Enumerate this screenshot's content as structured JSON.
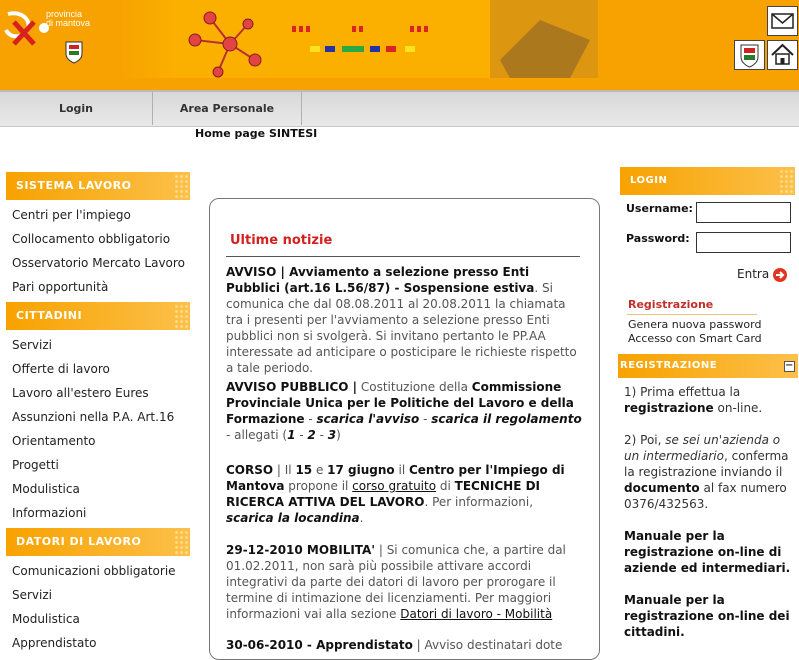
{
  "header": {
    "logo_line1": "provincia",
    "logo_line2": "di mantova",
    "icons": [
      "provincia-logo-icon",
      "coat-of-arms-icon",
      "molecule-icon",
      "mail-icon",
      "home-icon"
    ],
    "colors": {
      "brand_orange": "#f7a200",
      "accent_red": "#d32020"
    }
  },
  "nav": {
    "tabs": [
      {
        "label": "Login"
      },
      {
        "label": "Area Personale"
      }
    ],
    "breadcrumb": "Home page SINTESI"
  },
  "sidebar": {
    "sections": [
      {
        "title": "SISTEMA LAVORO",
        "items": [
          "Centri per l'impiego",
          "Collocamento obbligatorio",
          "Osservatorio Mercato Lavoro",
          "Pari opportunità"
        ]
      },
      {
        "title": "CITTADINI",
        "items": [
          "Servizi",
          "Offerte di lavoro",
          "Lavoro all'estero Eures",
          "Assunzioni nella P.A. Art.16",
          "Orientamento",
          "Progetti",
          "Modulistica",
          "Informazioni"
        ]
      },
      {
        "title": "DATORI DI LAVORO",
        "items": [
          "Comunicazioni obbligatorie",
          "Servizi",
          "Modulistica",
          "Apprendistato"
        ]
      }
    ]
  },
  "main": {
    "title": "Ultime notizie",
    "news": [
      {
        "heading": "AVVISO | Avviamento a selezione presso Enti Pubblici (art.16 L.56/87) - ",
        "heading_strong": "Sospensione estiva",
        "body": ". Si comunica che dal 08.08.2011 al 20.08.2011 la chiamata tra i presenti per l'avviamento a selezione presso Enti pubblici non si svolgerà. Si invitano pertanto le PP.AA interessate ad anticipare o posticipare le richieste rispetto a tale periodo."
      },
      {
        "t1": "AVVISO PUBBLICO |",
        "t2": " Costituzione della ",
        "t3": "Commissione Provinciale Unica per le Politiche del Lavoro e della Formazione",
        "t4": " - ",
        "t5": "scarica l'avviso",
        "t6": " - ",
        "t7": "scarica il regolamento",
        "t8": " - allegati (",
        "t9": "1",
        "t10": " - ",
        "t11": "2",
        "t12": " - ",
        "t13": "3",
        "t14": ")"
      },
      {
        "t1": "CORSO",
        "t2": " | Il ",
        "t3": "15",
        "t4": " e ",
        "t5": "17 giugno",
        "t6": " il ",
        "t7": "Centro per l'Impiego di Mantova",
        "t8": " propone il ",
        "t9": "corso gratuito",
        "t10": " di ",
        "t11": "TECNICHE DI RICERCA ATTIVA DEL LAVORO",
        "t12": ". Per informazioni, ",
        "t13": "scarica la locandina",
        "t14": "."
      },
      {
        "t1": "29-12-2010 MOBILITA'",
        "t2": " | Si comunica che, a partire dal 01.02.2011, non sarà più possibile attivare accordi integrativi da parte dei datori di lavoro per prorogare il termine di intimazione dei licenziamenti. Per maggiori informazioni vai alla sezione ",
        "t3": "Datori di lavoro - Mobilità"
      },
      {
        "t1": "30-06-2010 - Apprendistato",
        "t2": " | Avviso destinatari dote"
      }
    ]
  },
  "login_box": {
    "title": "LOGIN",
    "username_label": "Username:",
    "password_label": "Password:",
    "username_value": "",
    "password_value": "",
    "submit_label": "Entra",
    "registration_title": "Registrazione",
    "registration_links": [
      "Genera nuova password",
      "Accesso con Smart Card"
    ]
  },
  "registration_box": {
    "title": "REGISTRAZIONE",
    "collapse_symbol": "−",
    "step1_a": "1) Prima effettua la ",
    "step1_b": "registrazione",
    "step1_c": " on-line.",
    "step2_a": "2) Poi, ",
    "step2_b": "se sei un'azienda o un intermediario",
    "step2_c": ", conferma la registrazione inviando il ",
    "step2_d": "documento",
    "step2_e": " al fax numero 0376/432563.",
    "manual1": "Manuale per la registrazione on-line di aziende ed intermediari.",
    "manual2": "Manuale per la registrazione on-line dei cittadini."
  }
}
